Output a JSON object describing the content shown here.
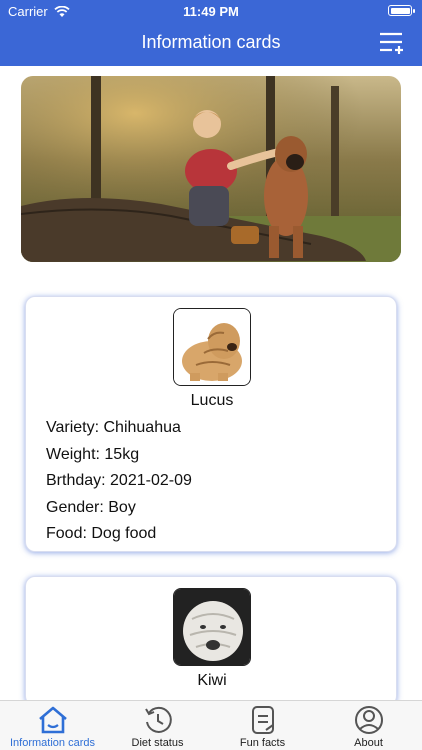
{
  "status_bar": {
    "carrier": "Carrier",
    "time": "11:49 PM"
  },
  "header": {
    "title": "Information cards",
    "menu_icon": "list-filter-icon"
  },
  "hero": {
    "image": "girl-with-dog-photo"
  },
  "cards": [
    {
      "name": "Lucus",
      "avatar": "shar-pei-puppy-photo",
      "variety": "Variety: Chihuahua",
      "weight": "Weight: 15kg",
      "birthday": "Brthday: 2021-02-09",
      "gender": "Gender: Boy",
      "food": "Food: Dog food"
    },
    {
      "name": "Kiwi",
      "avatar": "white-shar-pei-photo"
    }
  ],
  "tabs": [
    {
      "label": "Information cards",
      "icon": "home-icon",
      "active": true
    },
    {
      "label": "Diet status",
      "icon": "history-icon",
      "active": false
    },
    {
      "label": "Fun facts",
      "icon": "document-icon",
      "active": false
    },
    {
      "label": "About",
      "icon": "person-icon",
      "active": false
    }
  ],
  "colors": {
    "header": "#3b67d6",
    "active_tab": "#2f6fd6",
    "card_shadow": "#3c64d2"
  }
}
